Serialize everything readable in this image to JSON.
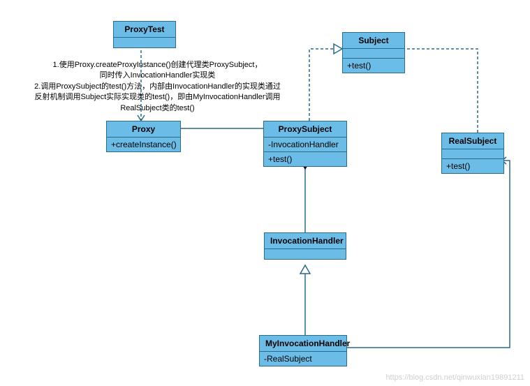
{
  "classes": {
    "proxyTest": {
      "name": "ProxyTest"
    },
    "subject": {
      "name": "Subject",
      "method": "+test()"
    },
    "proxy": {
      "name": "Proxy",
      "method": "+createInstance()"
    },
    "proxySubject": {
      "name": "ProxySubject",
      "attr": "-InvocationHandler",
      "method": "+test()"
    },
    "realSubject": {
      "name": "RealSubject",
      "method": "+test()"
    },
    "invocationHandler": {
      "name": "InvocationHandler"
    },
    "myInvocationHandler": {
      "name": "MyInvocationHandler",
      "attr": "-RealSubject"
    }
  },
  "notes": {
    "line1": "1.使用Proxy.createProxyInstance()创建代理类ProxySubject，",
    "line2": "同时传入InvocationHandler实现类",
    "line3": "2.调用ProxySubject的test()方法，内部由InvocationHandler的实现类通过",
    "line4": "反射机制调用Subject实际实现类的test()，即由MyInvocationHandler调用",
    "line5": "RealSubject类的test()"
  },
  "watermark": "https://blog.csdn.net/qinwuxian19891211"
}
